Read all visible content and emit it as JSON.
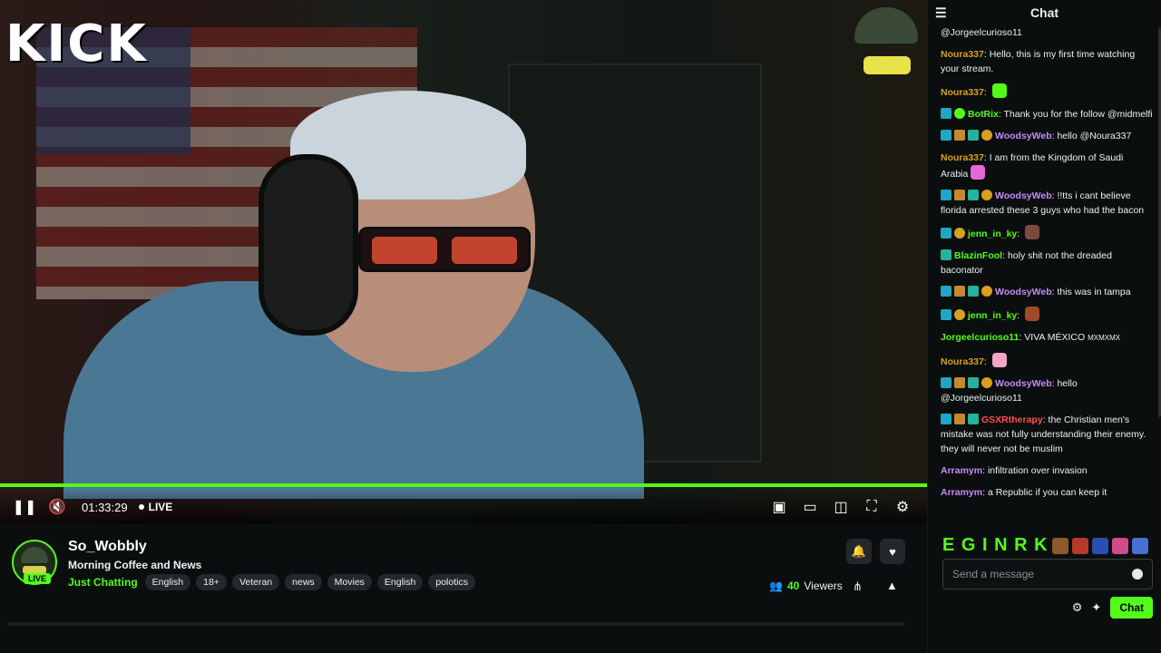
{
  "video": {
    "logo_text": "KICK",
    "time": "01:33:29",
    "live_label": "LIVE",
    "icons": [
      "pause-icon",
      "mute-icon",
      "miniplayer-icon",
      "theater-icon",
      "pip-icon",
      "fullscreen-icon",
      "settings-icon"
    ]
  },
  "stream": {
    "avatar_live": "LIVE",
    "channel_name": "So_Wobbly",
    "title": "Morning Coffee and News",
    "category": "Just Chatting",
    "tags": [
      "English",
      "18+",
      "Veteran",
      "news",
      "Movies",
      "English",
      "polotics"
    ],
    "viewers_count": "40",
    "viewers_label": "Viewers"
  },
  "chat": {
    "header": "Chat",
    "messages": [
      {
        "user": "",
        "text": "@Jorgeelcurioso11",
        "color": "#efeff1",
        "badges": []
      },
      {
        "user": "Noura337",
        "text": "Hello, this is my first time watching your stream.",
        "color": "#d6a21b",
        "badges": []
      },
      {
        "user": "Noura337",
        "text": "",
        "color": "#d6a21b",
        "badges": [],
        "emote": "#53fc18"
      },
      {
        "user": "BotRix",
        "text": "Thank you for the follow @midmelfi",
        "color": "#53fc18",
        "badges": [
          "mod",
          "ver"
        ]
      },
      {
        "user": "WoodsyWeb",
        "text": "hello @Noura337",
        "color": "#c58cf5",
        "badges": [
          "mod",
          "sub",
          "vip",
          "coin"
        ]
      },
      {
        "user": "Noura337",
        "text": "I am from the Kingdom of Saudi Arabia",
        "color": "#d6a21b",
        "badges": [],
        "emote": "#e667d6"
      },
      {
        "user": "WoodsyWeb",
        "text": "!!tts i cant believe florida arrested these 3 guys who had the bacon",
        "color": "#c58cf5",
        "badges": [
          "mod",
          "sub",
          "vip",
          "coin"
        ]
      },
      {
        "user": "jenn_in_ky",
        "text": "",
        "color": "#53fc18",
        "badges": [
          "mod",
          "coin"
        ],
        "emote": "#7b4a3c"
      },
      {
        "user": "BlazinFool",
        "text": "holy shit not the dreaded baconator",
        "color": "#53fc18",
        "badges": [
          "vip"
        ]
      },
      {
        "user": "WoodsyWeb",
        "text": "this was in tampa",
        "color": "#c58cf5",
        "badges": [
          "mod",
          "sub",
          "vip",
          "coin"
        ]
      },
      {
        "user": "jenn_in_ky",
        "text": "",
        "color": "#53fc18",
        "badges": [
          "mod",
          "coin"
        ],
        "emote": "#a04a2a"
      },
      {
        "user": "Jorgeelcurioso11",
        "text": "VIVA MÉXICO",
        "color": "#53fc18",
        "badges": [],
        "suffix": "MXMXMX"
      },
      {
        "user": "Noura337",
        "text": "",
        "color": "#d6a21b",
        "badges": [],
        "emote": "#f3a6c8"
      },
      {
        "user": "WoodsyWeb",
        "text": "hello @Jorgeelcurioso11",
        "color": "#c58cf5",
        "badges": [
          "mod",
          "sub",
          "vip",
          "coin"
        ]
      },
      {
        "user": "GSXRtherapy",
        "text": "the Christian men's mistake was not fully understanding their enemy. they will never not be muslim",
        "color": "#ff4d4d",
        "badges": [
          "mod",
          "sub",
          "vip"
        ]
      },
      {
        "user": "Arramym",
        "text": "infiltration over invasion",
        "color": "#c58cf5",
        "badges": []
      },
      {
        "user": "Arramym",
        "text": "a Republic if you can keep it",
        "color": "#c58cf5",
        "badges": []
      }
    ],
    "emote_bar_text": "E G I N R K",
    "input_placeholder": "Send a message",
    "send_label": "Chat"
  },
  "colors": {
    "accent": "#53fc18"
  }
}
